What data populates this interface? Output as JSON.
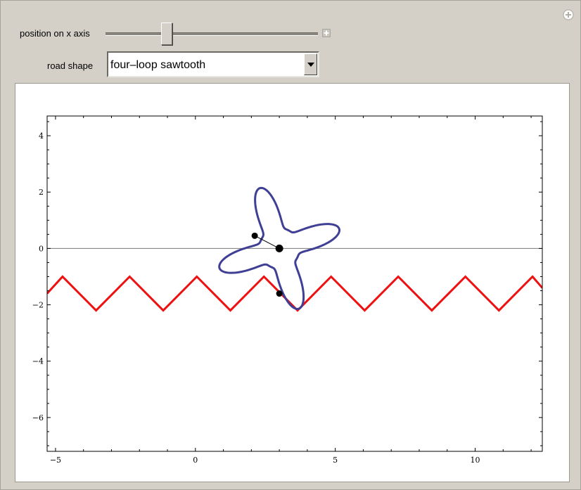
{
  "controls": {
    "position_label": "position on x axis",
    "position_value": 0.29,
    "road_label": "road shape",
    "road_selected": "four–loop sawtooth"
  },
  "icons": {
    "add": "plus-circle-icon",
    "slider_expand": "plus-square-icon",
    "dropdown": "triangle-down-icon"
  },
  "colors": {
    "road": "#ee1111",
    "wheel": "#3f3f96",
    "axis": "#777777",
    "point": "#000000"
  },
  "chart_data": {
    "type": "line",
    "xlim": [
      -5.3,
      12.4
    ],
    "ylim": [
      -7.2,
      4.7
    ],
    "xticks": [
      -5,
      0,
      5,
      10
    ],
    "yticks": [
      4,
      2,
      0,
      -2,
      -4,
      -6
    ],
    "xtick_labels": [
      "−5",
      "0",
      "5",
      "10"
    ],
    "ytick_labels": [
      "4",
      "2",
      "0",
      "−2",
      "−4",
      "−6"
    ],
    "grid": false,
    "axis_line_y": 0,
    "series": [
      {
        "kind": "road",
        "x": [
          -5.3,
          -4.75,
          -3.55,
          -2.35,
          -1.15,
          0.05,
          1.25,
          2.45,
          3.65,
          4.85,
          6.05,
          7.25,
          8.45,
          9.65,
          10.85,
          12.05,
          12.4
        ],
        "y": [
          -1.6,
          -1.0,
          -2.2,
          -1.0,
          -2.2,
          -1.0,
          -2.2,
          -1.0,
          -2.2,
          -1.0,
          -2.2,
          -1.0,
          -2.2,
          -1.0,
          -2.2,
          -1.0,
          -1.4
        ]
      },
      {
        "kind": "wheel",
        "center": [
          3.0,
          0.0
        ],
        "lobe_radius": 2.25,
        "inner_radius": 0.72,
        "rotation_deg": 18,
        "lobes": 4
      },
      {
        "kind": "points",
        "points": [
          [
            3.0,
            0.0
          ],
          [
            2.12,
            0.45
          ],
          [
            3.0,
            -1.6
          ]
        ],
        "sizes": [
          11,
          9,
          9
        ]
      },
      {
        "kind": "spoke",
        "from": [
          3.0,
          0.0
        ],
        "to": [
          2.12,
          0.45
        ]
      }
    ]
  }
}
